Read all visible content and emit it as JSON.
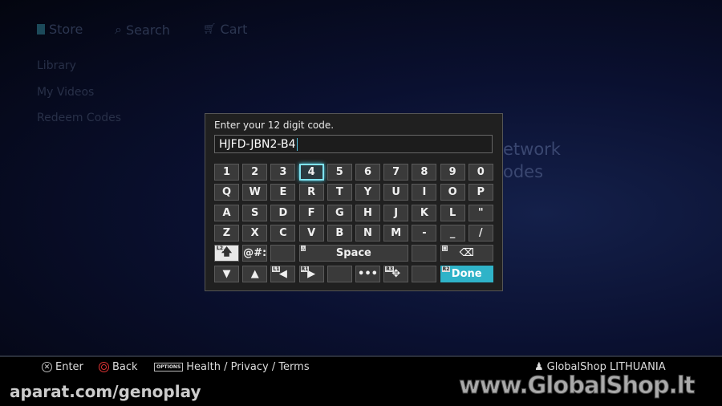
{
  "nav": {
    "store": "Store",
    "search": "Search",
    "cart": "Cart"
  },
  "sidebar": {
    "items": [
      {
        "label": "Library"
      },
      {
        "label": "My Videos"
      },
      {
        "label": "Redeem Codes"
      }
    ]
  },
  "background_text": {
    "line1": "etwork",
    "line2": "odes"
  },
  "dialog": {
    "prompt": "Enter your 12 digit code.",
    "value": "HJFD-JBN2-B4",
    "rows": [
      [
        "1",
        "2",
        "3",
        "4",
        "5",
        "6",
        "7",
        "8",
        "9",
        "0"
      ],
      [
        "Q",
        "W",
        "E",
        "R",
        "T",
        "Y",
        "U",
        "I",
        "O",
        "P"
      ],
      [
        "A",
        "S",
        "D",
        "F",
        "G",
        "H",
        "J",
        "K",
        "L",
        "\""
      ],
      [
        "Z",
        "X",
        "C",
        "V",
        "B",
        "N",
        "M",
        "-",
        "_",
        "/"
      ]
    ],
    "selected_key": "4",
    "symbols_label": "@#:",
    "space_label": "Space",
    "done_label": "Done",
    "more_label": "•••",
    "tags": {
      "shift": "L2",
      "space": "△",
      "backspace": "□",
      "left": "L1",
      "right": "R1",
      "gamepad": "R3",
      "done": "R2"
    },
    "accent_color": "#2fb3c8"
  },
  "footer": {
    "enter": "Enter",
    "back": "Back",
    "options_badge": "OPTIONS",
    "links": "Health / Privacy / Terms",
    "region": "GlobalShop LITHUANIA"
  },
  "watermarks": {
    "left": "aparat.com/genoplay",
    "right": "www.GlobalShop.lt"
  }
}
